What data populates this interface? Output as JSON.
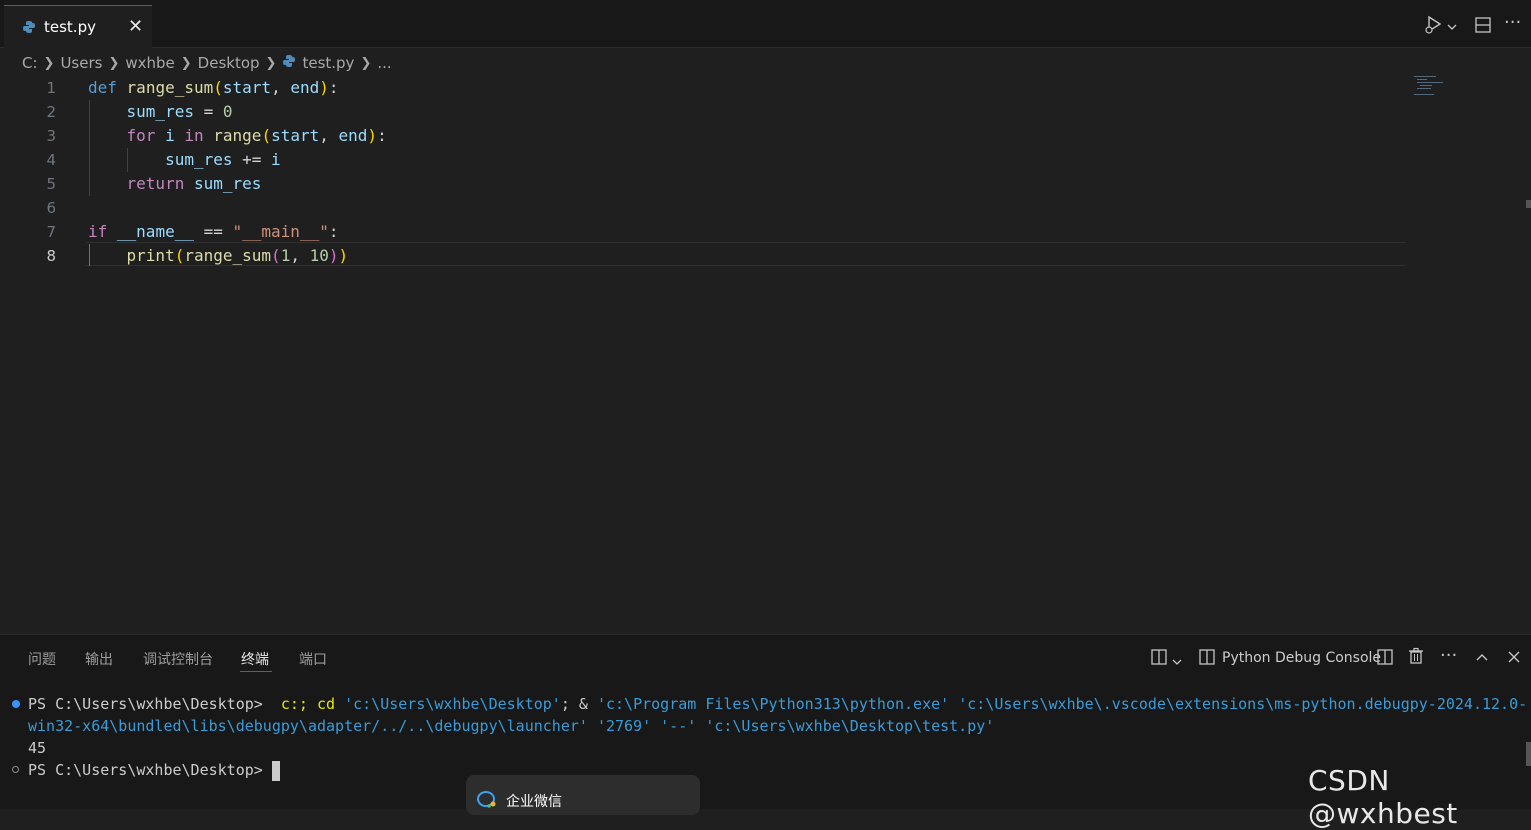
{
  "tab": {
    "filename": "test.py",
    "close_glyph": "✕"
  },
  "toolbar": {
    "run_icon": "▷",
    "chevron": "⌵",
    "split_icon": "⊟",
    "more": "···"
  },
  "breadcrumb": {
    "parts": [
      "C:",
      "Users",
      "wxhbe",
      "Desktop"
    ],
    "file": "test.py",
    "ellipsis": "..."
  },
  "editor": {
    "line_numbers": [
      "1",
      "2",
      "3",
      "4",
      "5",
      "6",
      "7",
      "8"
    ],
    "lines": [
      [
        {
          "t": "def",
          "c": "kw"
        },
        {
          "t": " ",
          "c": "op"
        },
        {
          "t": "range_sum",
          "c": "fn"
        },
        {
          "t": "(",
          "c": "br1"
        },
        {
          "t": "start",
          "c": "var"
        },
        {
          "t": ", ",
          "c": "op"
        },
        {
          "t": "end",
          "c": "var"
        },
        {
          "t": ")",
          "c": "br1"
        },
        {
          "t": ":",
          "c": "op"
        }
      ],
      [
        {
          "t": "    ",
          "c": "op"
        },
        {
          "t": "sum_res",
          "c": "var"
        },
        {
          "t": " = ",
          "c": "op"
        },
        {
          "t": "0",
          "c": "num"
        }
      ],
      [
        {
          "t": "    ",
          "c": "op"
        },
        {
          "t": "for",
          "c": "kw2"
        },
        {
          "t": " ",
          "c": "op"
        },
        {
          "t": "i",
          "c": "var"
        },
        {
          "t": " ",
          "c": "op"
        },
        {
          "t": "in",
          "c": "kw2"
        },
        {
          "t": " ",
          "c": "op"
        },
        {
          "t": "range",
          "c": "fn"
        },
        {
          "t": "(",
          "c": "br1"
        },
        {
          "t": "start",
          "c": "var"
        },
        {
          "t": ", ",
          "c": "op"
        },
        {
          "t": "end",
          "c": "var"
        },
        {
          "t": ")",
          "c": "br1"
        },
        {
          "t": ":",
          "c": "op"
        }
      ],
      [
        {
          "t": "        ",
          "c": "op"
        },
        {
          "t": "sum_res",
          "c": "var"
        },
        {
          "t": " += ",
          "c": "op"
        },
        {
          "t": "i",
          "c": "var"
        }
      ],
      [
        {
          "t": "    ",
          "c": "op"
        },
        {
          "t": "return",
          "c": "kw2"
        },
        {
          "t": " ",
          "c": "op"
        },
        {
          "t": "sum_res",
          "c": "var"
        }
      ],
      [],
      [
        {
          "t": "if",
          "c": "kw2"
        },
        {
          "t": " ",
          "c": "op"
        },
        {
          "t": "__name__",
          "c": "var"
        },
        {
          "t": " == ",
          "c": "op"
        },
        {
          "t": "\"__main__\"",
          "c": "str"
        },
        {
          "t": ":",
          "c": "op"
        }
      ],
      [
        {
          "t": "    ",
          "c": "op"
        },
        {
          "t": "print",
          "c": "fn"
        },
        {
          "t": "(",
          "c": "br1"
        },
        {
          "t": "range_sum",
          "c": "fn"
        },
        {
          "t": "(",
          "c": "br2"
        },
        {
          "t": "1",
          "c": "num"
        },
        {
          "t": ", ",
          "c": "op"
        },
        {
          "t": "10",
          "c": "num"
        },
        {
          "t": ")",
          "c": "br2"
        },
        {
          "t": ")",
          "c": "br1"
        }
      ]
    ],
    "active_line": 8
  },
  "panel": {
    "tabs": [
      "问题",
      "输出",
      "调试控制台",
      "终端",
      "端口"
    ],
    "active_tab": "终端",
    "terminal_name": "Python Debug Console"
  },
  "terminal": {
    "prompt": "PS C:\\Users\\wxhbe\\Desktop> ",
    "cmd_part1": " c:; cd ",
    "arg1": "'c:\\Users\\wxhbe\\Desktop'",
    "cmd_part2": "; & ",
    "arg2": "'c:\\Program Files\\Python313\\python.exe'",
    "arg3": " 'c:\\Users\\wxhbe\\.vscode\\extensions\\ms-python.debugpy-2024.12.0-",
    "line2": "win32-x64\\bundled\\libs\\debugpy\\adapter/../..\\debugpy\\launcher' '2769' '--' 'c:\\Users\\wxhbe\\Desktop\\test.py'",
    "output": "45",
    "prompt2": "PS C:\\Users\\wxhbe\\Desktop> "
  },
  "popup": {
    "label": "企业微信"
  },
  "watermark": "CSDN @wxhbest"
}
